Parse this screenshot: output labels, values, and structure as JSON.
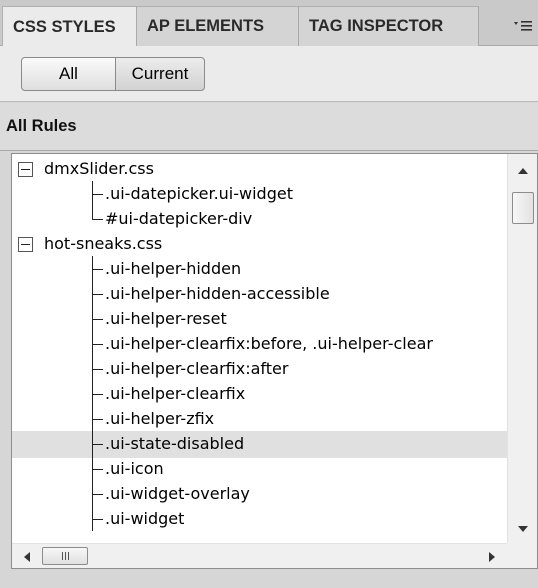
{
  "tabs": [
    {
      "label": "CSS STYLES",
      "active": true
    },
    {
      "label": "AP ELEMENTS",
      "active": false
    },
    {
      "label": "TAG INSPECTOR",
      "active": false
    }
  ],
  "toolbar": {
    "all_label": "All",
    "current_label": "Current"
  },
  "section": {
    "title": "All Rules"
  },
  "tree": [
    {
      "label": "dmxSlider.css",
      "type": "file"
    },
    {
      "label": ".ui-datepicker.ui-widget",
      "type": "rule"
    },
    {
      "label": "#ui-datepicker-div",
      "type": "rule",
      "last": true
    },
    {
      "label": "hot-sneaks.css",
      "type": "file"
    },
    {
      "label": ".ui-helper-hidden",
      "type": "rule"
    },
    {
      "label": ".ui-helper-hidden-accessible",
      "type": "rule"
    },
    {
      "label": ".ui-helper-reset",
      "type": "rule"
    },
    {
      "label": ".ui-helper-clearfix:before, .ui-helper-clear",
      "type": "rule"
    },
    {
      "label": ".ui-helper-clearfix:after",
      "type": "rule"
    },
    {
      "label": ".ui-helper-clearfix",
      "type": "rule"
    },
    {
      "label": ".ui-helper-zfix",
      "type": "rule"
    },
    {
      "label": ".ui-state-disabled",
      "type": "rule",
      "selected": true
    },
    {
      "label": ".ui-icon",
      "type": "rule"
    },
    {
      "label": ".ui-widget-overlay",
      "type": "rule"
    },
    {
      "label": ".ui-widget",
      "type": "rule"
    }
  ],
  "icons": {
    "panel_menu": "panel-options-menu-icon",
    "collapse": "collapse-minus-icon",
    "scroll_up": "scroll-up-arrow-icon",
    "scroll_down": "scroll-down-arrow-icon",
    "scroll_left": "scroll-left-arrow-icon",
    "scroll_right": "scroll-right-arrow-icon"
  },
  "colors": {
    "selected_row": "#e0e0e0",
    "active_tab": "#ebebeb"
  }
}
